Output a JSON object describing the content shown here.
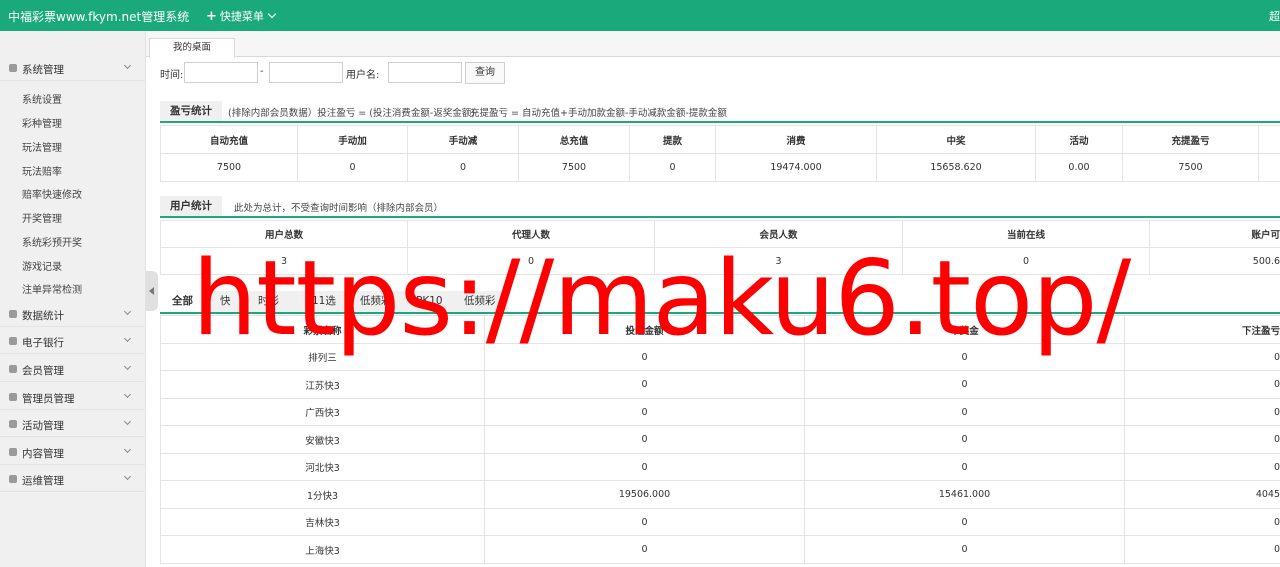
{
  "header": {
    "brand": "中福彩票www.fkym.net管理系统",
    "quick_menu": "快捷菜单",
    "right_text": "超"
  },
  "sidebar": {
    "groups": [
      {
        "label": "系统管理",
        "items": [
          "系统设置",
          "彩种管理",
          "玩法管理",
          "玩法赔率",
          "赔率快速修改",
          "开奖管理",
          "系统彩预开奖",
          "游戏记录",
          "注单异常检测"
        ]
      },
      {
        "label": "数据统计"
      },
      {
        "label": "电子银行"
      },
      {
        "label": "会员管理"
      },
      {
        "label": "管理员管理"
      },
      {
        "label": "活动管理"
      },
      {
        "label": "内容管理"
      },
      {
        "label": "运维管理"
      }
    ]
  },
  "tabs": {
    "desk": "我的桌面"
  },
  "search": {
    "time_label": "时间:",
    "dash": "-",
    "user_label": "用户名:",
    "query_button": "查询"
  },
  "profit": {
    "title": "盈亏统计",
    "note1": "(排除内部会员数据）投注盈亏 = (投注消费金额-返奖金额)",
    "note2": "充提盈亏 = 自动充值+手动加款金额-手动减款金额-提款金额",
    "headers": [
      "自动充值",
      "手动加",
      "手动减",
      "总充值",
      "提款",
      "消费",
      "中奖",
      "活动",
      "充提盈亏"
    ],
    "values": [
      "7500",
      "0",
      "0",
      "7500",
      "0",
      "19474.000",
      "15658.620",
      "0.00",
      "7500"
    ]
  },
  "users": {
    "title": "用户统计",
    "note": "此处为总计，不受查询时间影响（排除内部会员）",
    "headers": [
      "用户总数",
      "代理人数",
      "会员人数",
      "当前在线",
      "账户可"
    ],
    "values": [
      "3",
      "0",
      "3",
      "0",
      "500.6"
    ]
  },
  "lottery": {
    "tabs": [
      "全部",
      "快",
      "时彩",
      "11选",
      "低频彩",
      "PK10",
      "低频彩"
    ],
    "headers": [
      "彩票名称",
      "投注金额",
      "中奖金",
      "下注盈亏"
    ],
    "rows": [
      [
        "排列三",
        "0",
        "0",
        "0"
      ],
      [
        "江苏快3",
        "0",
        "0",
        "0"
      ],
      [
        "广西快3",
        "0",
        "0",
        "0"
      ],
      [
        "安徽快3",
        "0",
        "0",
        "0"
      ],
      [
        "河北快3",
        "0",
        "0",
        "0"
      ],
      [
        "1分快3",
        "19506.000",
        "15461.000",
        "4045"
      ],
      [
        "吉林快3",
        "0",
        "0",
        "0"
      ],
      [
        "上海快3",
        "0",
        "0",
        "0"
      ]
    ]
  },
  "watermark": "https://maku6.top/",
  "colors": {
    "accent": "#1aa97b",
    "watermark": "#ff0000"
  }
}
